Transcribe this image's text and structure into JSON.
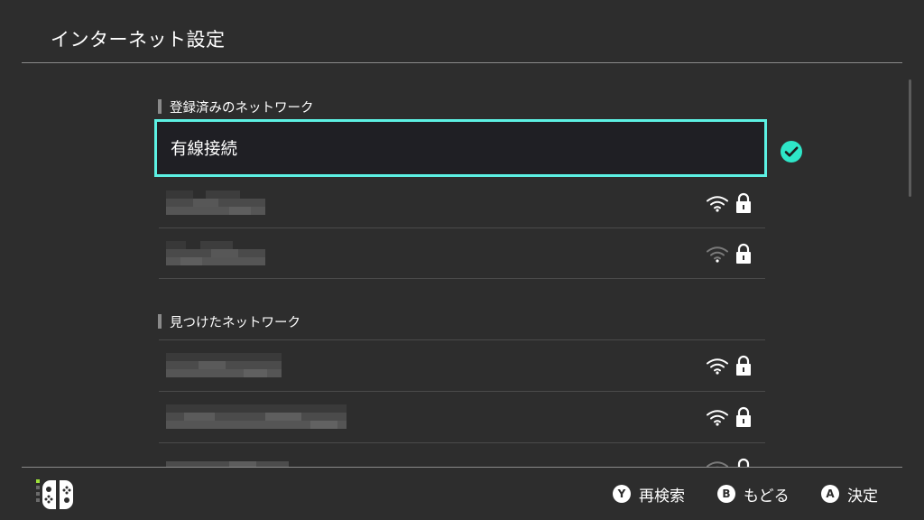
{
  "header": {
    "title": "インターネット設定"
  },
  "registered": {
    "section_label": "登録済みのネットワーク",
    "wired_label": "有線接続",
    "networks": [
      {
        "name_redacted": true,
        "signal": "strong",
        "locked": true
      },
      {
        "name_redacted": true,
        "signal": "weak",
        "locked": true
      }
    ]
  },
  "found": {
    "section_label": "見つけたネットワーク",
    "networks": [
      {
        "name_redacted": true,
        "signal": "strong",
        "locked": true
      },
      {
        "name_redacted": true,
        "signal": "strong",
        "locked": true
      },
      {
        "name_redacted": true,
        "signal": "weak",
        "locked": true
      }
    ]
  },
  "footer": {
    "hints": [
      {
        "button": "Y",
        "label": "再検索"
      },
      {
        "button": "B",
        "label": "もどる"
      },
      {
        "button": "A",
        "label": "決定"
      }
    ]
  },
  "colors": {
    "background": "#2d2d2d",
    "selection_outline": "#5cf0e3",
    "check": "#2ee6c8",
    "divider": "#8a8a8a"
  },
  "icons": {
    "connected": "check-circle-icon",
    "signal": "wifi-icon",
    "secure": "lock-icon",
    "controller": "joycon-icon"
  }
}
